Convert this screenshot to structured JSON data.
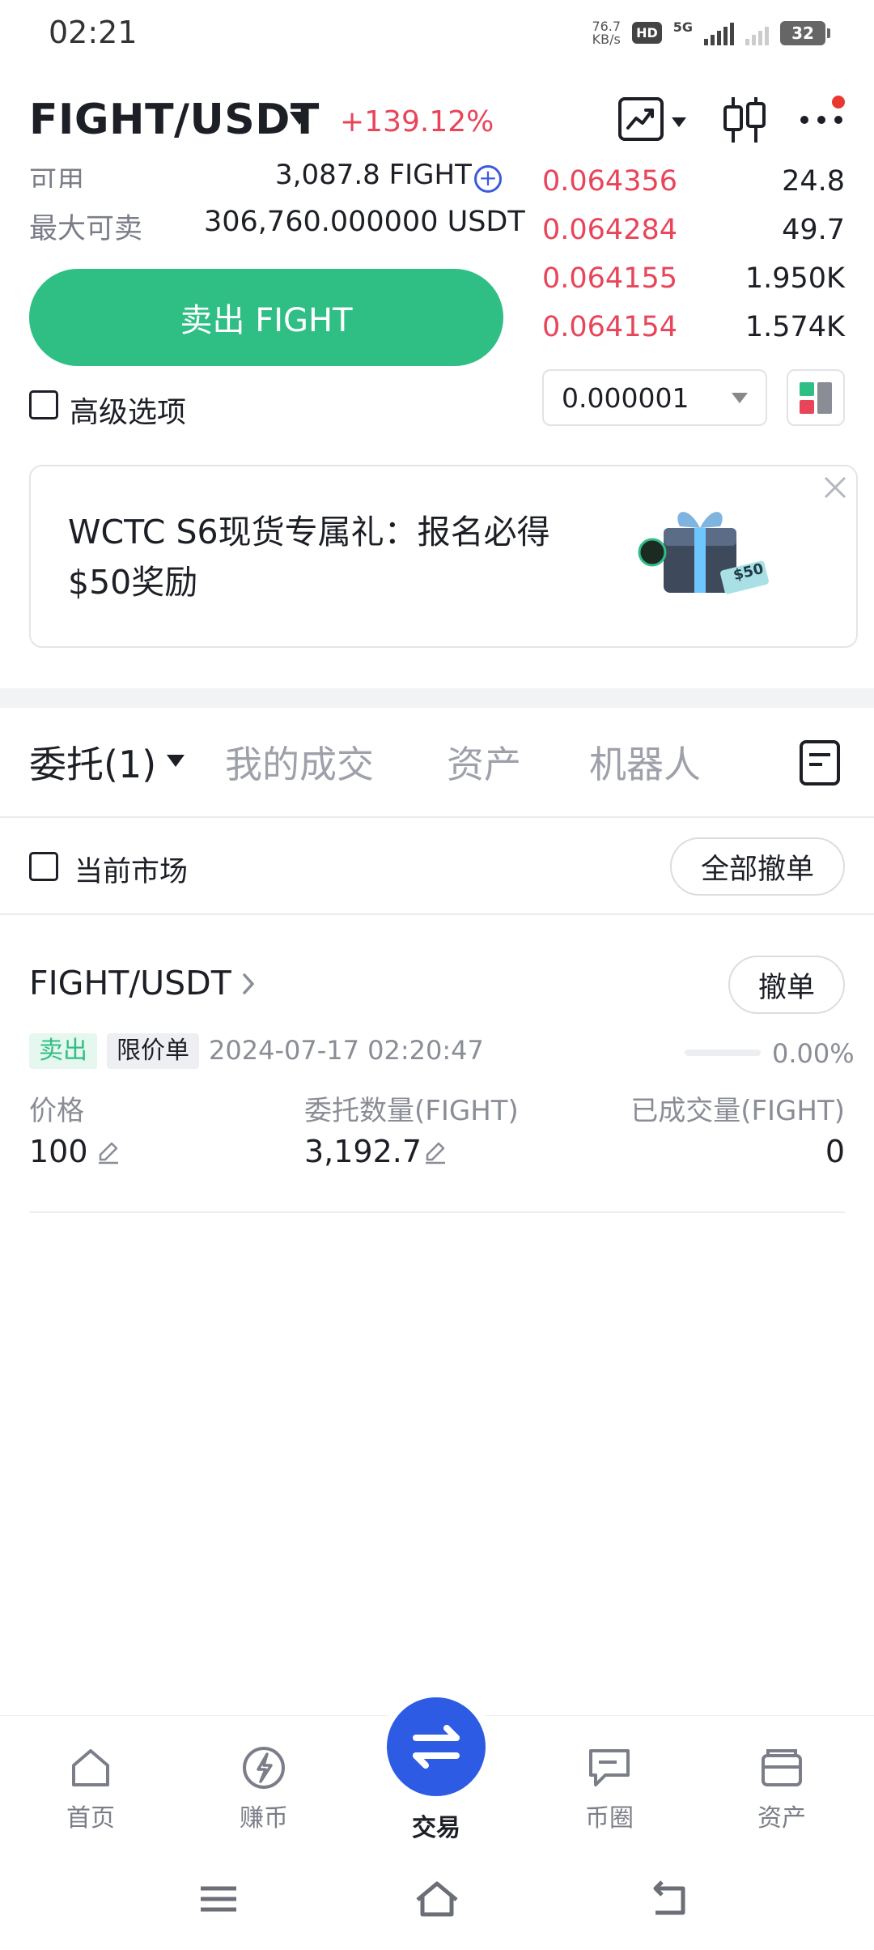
{
  "status_bar": {
    "time": "02:21",
    "net_speed_value": "76.7",
    "net_speed_unit": "KB/s",
    "hd": "HD",
    "network": "5G",
    "battery": "32"
  },
  "header": {
    "pair": "FIGHT/USDT",
    "change": "+139.12%",
    "icons": [
      "chart-type-icon",
      "candlestick-icon",
      "more-icon"
    ]
  },
  "form": {
    "available_label": "可用",
    "available_value": "3,087.8 FIGHT",
    "max_sell_label": "最大可卖",
    "max_sell_value": "306,760.000000 USDT",
    "sell_button": "卖出 FIGHT",
    "advanced_label": "高级选项"
  },
  "orderbook": {
    "asks": [
      {
        "price": "0.064356",
        "qty": "24.8"
      },
      {
        "price": "0.064284",
        "qty": "49.7"
      },
      {
        "price": "0.064155",
        "qty": "1.950K"
      },
      {
        "price": "0.064154",
        "qty": "1.574K"
      }
    ],
    "precision": "0.000001"
  },
  "banner": {
    "text": "WCTC S6现货专属礼：报名必得$50奖励",
    "gift_label": "$50"
  },
  "tabs": {
    "items": [
      {
        "label": "委托(1)",
        "active": true
      },
      {
        "label": "我的成交",
        "active": false
      },
      {
        "label": "资产",
        "active": false
      },
      {
        "label": "机器人",
        "active": false
      }
    ]
  },
  "filter": {
    "current_market": "当前市场",
    "cancel_all": "全部撤单"
  },
  "order": {
    "pair": "FIGHT/USDT",
    "cancel": "撤单",
    "side": "卖出",
    "type": "限价单",
    "time": "2024-07-17 02:20:47",
    "filled_pct": "0.00%",
    "filled_fraction": 0,
    "price_label": "价格",
    "price_value": "100",
    "amount_label": "委托数量(FIGHT)",
    "amount_value": "3,192.7",
    "filled_label": "已成交量(FIGHT)",
    "filled_value": "0"
  },
  "bottom_nav": {
    "items": [
      {
        "label": "首页",
        "icon": "home-icon"
      },
      {
        "label": "赚币",
        "icon": "earn-icon"
      },
      {
        "label": "交易",
        "icon": "trade-icon",
        "active": true
      },
      {
        "label": "币圈",
        "icon": "community-icon"
      },
      {
        "label": "资产",
        "icon": "wallet-icon"
      }
    ]
  },
  "colors": {
    "accent_green": "#2fbf85",
    "ask_red": "#e8455a",
    "trade_blue": "#2d5be3"
  }
}
